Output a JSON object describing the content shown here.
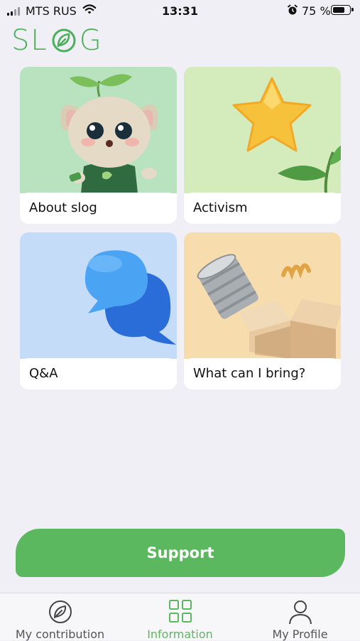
{
  "status_bar": {
    "carrier": "MTS RUS",
    "time": "13:31",
    "battery": "75 %",
    "battery_level": 0.75
  },
  "app": {
    "logo_text": "SLOG",
    "accent_color": "#5cb85f"
  },
  "cards": [
    {
      "label": "About slog"
    },
    {
      "label": "Activism"
    },
    {
      "label": "Q&A"
    },
    {
      "label": "What can I bring?"
    }
  ],
  "support_button": {
    "label": "Support"
  },
  "tab_bar": {
    "tabs": [
      {
        "label": "My contribution",
        "icon": "leaf-circle-icon",
        "active": false
      },
      {
        "label": "Information",
        "icon": "grid-icon",
        "active": true
      },
      {
        "label": "My Profile",
        "icon": "person-icon",
        "active": false
      }
    ]
  }
}
